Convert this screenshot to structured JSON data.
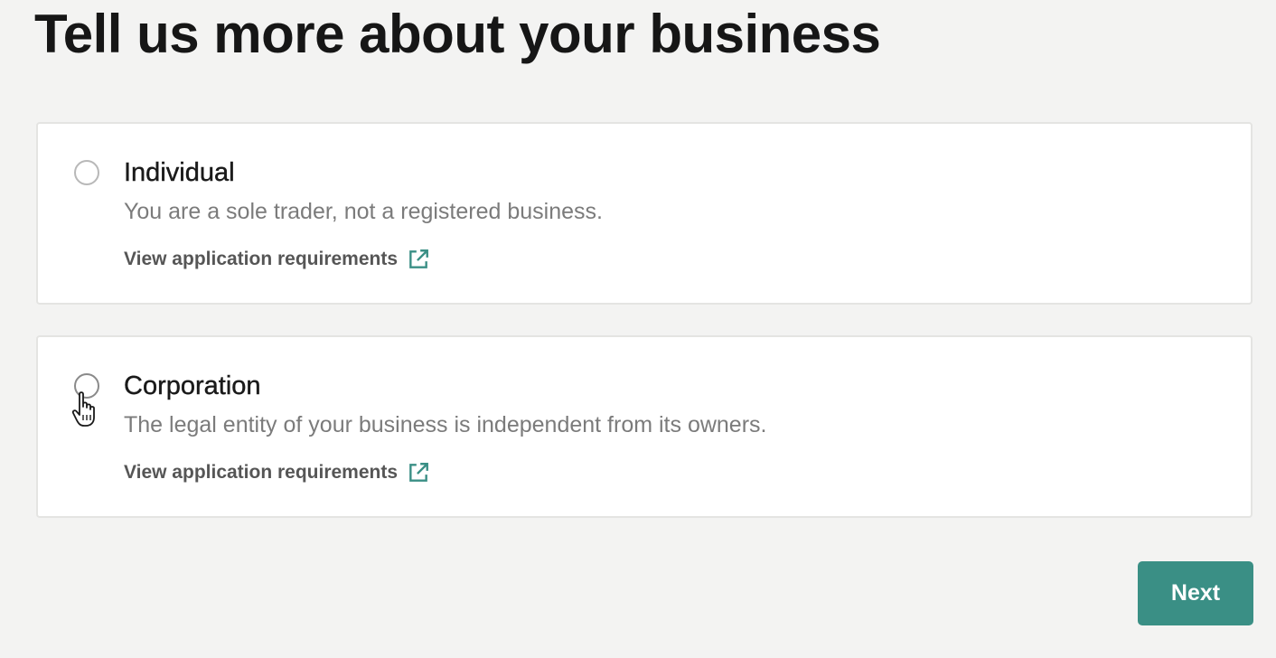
{
  "page": {
    "title": "Tell us more about your business"
  },
  "options": [
    {
      "title": "Individual",
      "description": "You are a sole trader, not a registered business.",
      "link_label": "View application requirements",
      "selected": false
    },
    {
      "title": "Corporation",
      "description": "The legal entity of your business is independent from its owners.",
      "link_label": "View application requirements",
      "selected": false
    }
  ],
  "actions": {
    "next_label": "Next"
  },
  "icons": {
    "link_icon": "external-link-icon",
    "cursor": "hand-pointer-icon"
  },
  "colors": {
    "accent": "#3a8f85",
    "background": "#f3f3f2",
    "card": "#ffffff"
  }
}
